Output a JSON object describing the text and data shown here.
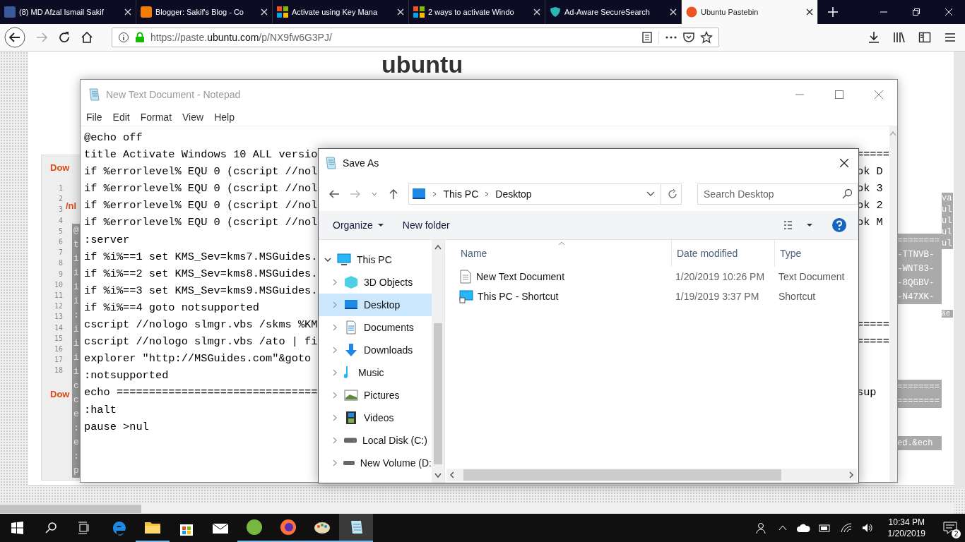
{
  "browser": {
    "tabs": [
      {
        "title": "(8) MD Afzal Ismail Sakif",
        "selected": false
      },
      {
        "title": "Blogger: Sakif's Blog - Co",
        "selected": false
      },
      {
        "title": "Activate using Key Mana",
        "selected": false
      },
      {
        "title": "2 ways to activate Windo",
        "selected": false
      },
      {
        "title": "Ad-Aware SecureSearch",
        "selected": false
      },
      {
        "title": "Ubuntu Pastebin",
        "selected": true
      }
    ],
    "url": {
      "before": "https://paste.",
      "domain": "ubuntu.com",
      "after": "/p/NX9fw6G3PJ/"
    }
  },
  "page": {
    "logo": "ubuntu",
    "download_labels": [
      "Dow",
      "Dow"
    ],
    "fragment": "/nl",
    "line_numbers": [
      "1",
      "2",
      "3",
      "4",
      "5",
      "6",
      "7",
      "8",
      "9",
      "10",
      "11",
      "12",
      "13",
      "14",
      "15",
      "16",
      "17",
      "18"
    ],
    "left_code": [
      "@",
      "t",
      "i",
      "i",
      "i",
      "i",
      ":",
      "i",
      "i",
      "i",
      "i",
      "c",
      "c",
      "e",
      ":",
      "e",
      ":",
      "p"
    ],
    "right_code": [
      "va",
      "ul",
      "ul",
      "ul",
      "ul"
    ],
    "key_lines": [
      "========",
      "-TTNVB-",
      "-WNT83-",
      "-8QGBV-",
      "-N47XK-"
    ],
    "note": "&e",
    "rule_lines": [
      "========",
      "========"
    ],
    "last_line": "ed.&ech"
  },
  "notepad": {
    "title": "New Text Document - Notepad",
    "menu": [
      "File",
      "Edit",
      "Format",
      "View",
      "Help"
    ],
    "lines": [
      {
        "text": "@echo off"
      },
      {
        "text": "title Activate Windows 10 ALL versio",
        "tail": "====="
      },
      {
        "text": "if %errorlevel% EQU 0 (cscript //nol",
        "tail": "ok D"
      },
      {
        "text": "if %errorlevel% EQU 0 (cscript //nol",
        "tail": "ok 3"
      },
      {
        "text": "if %errorlevel% EQU 0 (cscript //nol",
        "tail": "ok 2"
      },
      {
        "text": "if %errorlevel% EQU 0 (cscript //nol",
        "tail": "ok M"
      },
      {
        "text": ":server"
      },
      {
        "text": "if %i%==1 set KMS_Sev=kms7.MSGuides."
      },
      {
        "text": "if %i%==2 set KMS_Sev=kms8.MSGuides."
      },
      {
        "text": "if %i%==3 set KMS_Sev=kms9.MSGuides."
      },
      {
        "text": "if %i%==4 goto notsupported"
      },
      {
        "text": "cscript //nologo slmgr.vbs /skms %KM",
        "tail": "====="
      },
      {
        "text": "cscript //nologo slmgr.vbs /ato | fi",
        "tail": "====="
      },
      {
        "text": "explorer \"http://MSGuides.com\"&goto"
      },
      {
        "text": ":notsupported"
      },
      {
        "text": "echo ===============================",
        "tail": "sup"
      },
      {
        "text": ":halt"
      },
      {
        "text": "pause >nul"
      }
    ]
  },
  "save_as": {
    "title": "Save As",
    "path": [
      "This PC",
      "Desktop"
    ],
    "search": {
      "placeholder": "Search Desktop"
    },
    "toolbar": {
      "organize": "Organize",
      "new_folder": "New folder"
    },
    "tree": [
      {
        "label": "This PC",
        "expanded": true,
        "selected": false,
        "children": [
          {
            "label": "3D Objects",
            "expanded": false,
            "selected": false
          },
          {
            "label": "Desktop",
            "expanded": false,
            "selected": true
          },
          {
            "label": "Documents",
            "expanded": false,
            "selected": false
          },
          {
            "label": "Downloads",
            "expanded": false,
            "selected": false
          },
          {
            "label": "Music",
            "expanded": false,
            "selected": false
          },
          {
            "label": "Pictures",
            "expanded": false,
            "selected": false
          },
          {
            "label": "Videos",
            "expanded": false,
            "selected": false
          },
          {
            "label": "Local Disk (C:)",
            "expanded": false,
            "selected": false
          },
          {
            "label": "New Volume (D:",
            "expanded": false,
            "selected": false
          }
        ]
      }
    ],
    "columns": [
      "Name",
      "Date modified",
      "Type"
    ],
    "files": [
      {
        "name": "New Text Document",
        "date": "1/20/2019 10:26 PM",
        "type": "Text Document"
      },
      {
        "name": "This PC - Shortcut",
        "date": "1/19/2019 3:37 PM",
        "type": "Shortcut"
      }
    ]
  },
  "taskbar": {
    "apps": [
      {
        "running": false,
        "selected": false
      },
      {
        "running": true,
        "selected": false
      },
      {
        "running": false,
        "selected": false
      },
      {
        "running": false,
        "selected": false
      },
      {
        "running": true,
        "selected": false
      },
      {
        "running": true,
        "selected": false
      },
      {
        "running": true,
        "selected": false
      },
      {
        "running": true,
        "selected": true
      }
    ],
    "time": "10:34 PM",
    "date": "1/20/2019",
    "notifications": "2"
  }
}
